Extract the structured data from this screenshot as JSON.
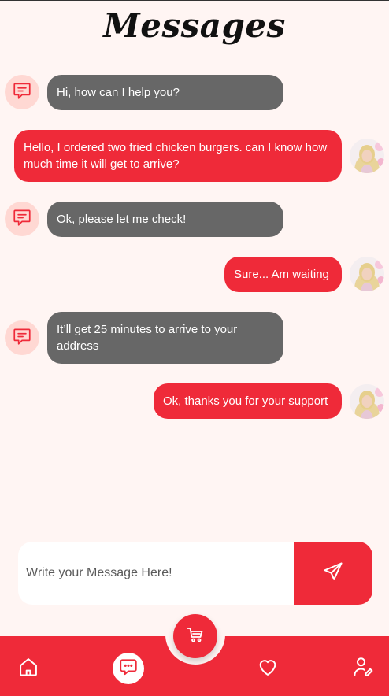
{
  "header": {
    "title": "Messages"
  },
  "messages": [
    {
      "sender": "support",
      "text": "Hi, how can I help you?"
    },
    {
      "sender": "user",
      "text": "Hello, I ordered two fried chicken burgers. can I know how much time it will get to arrive?"
    },
    {
      "sender": "support",
      "text": "Ok, please let me check!"
    },
    {
      "sender": "user",
      "text": "Sure... Am waiting"
    },
    {
      "sender": "support",
      "text": "It’ll get 25 minutes to arrive to your address"
    },
    {
      "sender": "user",
      "text": "Ok, thanks you for your support"
    }
  ],
  "composer": {
    "placeholder": "Write your Message Here!",
    "value": ""
  },
  "nav": {
    "items": [
      "home-icon",
      "chat-icon",
      "cart-icon",
      "heart-icon",
      "profile-edit-icon"
    ],
    "active": "chat-icon"
  },
  "colors": {
    "accent": "#ef2a39",
    "incoming_bubble": "#676767",
    "background": "#fff5f3",
    "bot_avatar_bg": "#ffd8d3"
  }
}
